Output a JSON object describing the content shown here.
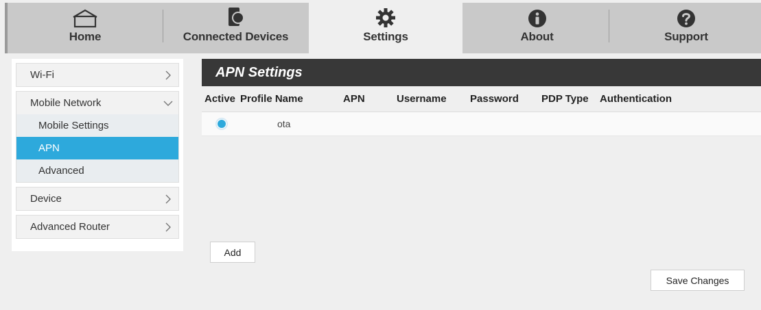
{
  "topnav": {
    "tabs": [
      {
        "label": "Home",
        "icon": "home-icon",
        "active": false
      },
      {
        "label": "Connected Devices",
        "icon": "devices-icon",
        "active": false
      },
      {
        "label": "Settings",
        "icon": "gear-icon",
        "active": true
      },
      {
        "label": "About",
        "icon": "info-icon",
        "active": false
      },
      {
        "label": "Support",
        "icon": "help-icon",
        "active": false
      }
    ]
  },
  "sidebar": {
    "groups": [
      {
        "label": "Wi-Fi",
        "expanded": false
      },
      {
        "label": "Mobile Network",
        "expanded": true,
        "items": [
          {
            "label": "Mobile Settings",
            "selected": false
          },
          {
            "label": "APN",
            "selected": true
          },
          {
            "label": "Advanced",
            "selected": false
          }
        ]
      },
      {
        "label": "Device",
        "expanded": false
      },
      {
        "label": "Advanced Router",
        "expanded": false
      }
    ]
  },
  "main": {
    "title": "APN Settings",
    "columns": [
      "Active",
      "Profile Name",
      "APN",
      "Username",
      "Password",
      "PDP Type",
      "Authentication"
    ],
    "rows": [
      {
        "active": true,
        "profile_name": "ota",
        "apn": "",
        "username": "",
        "password": "",
        "pdp_type": "",
        "authentication": ""
      }
    ],
    "add_label": "Add",
    "save_label": "Save Changes"
  },
  "colors": {
    "accent": "#2da9dc",
    "header_bg": "#383838",
    "nav_bg": "#c9c9c9"
  }
}
